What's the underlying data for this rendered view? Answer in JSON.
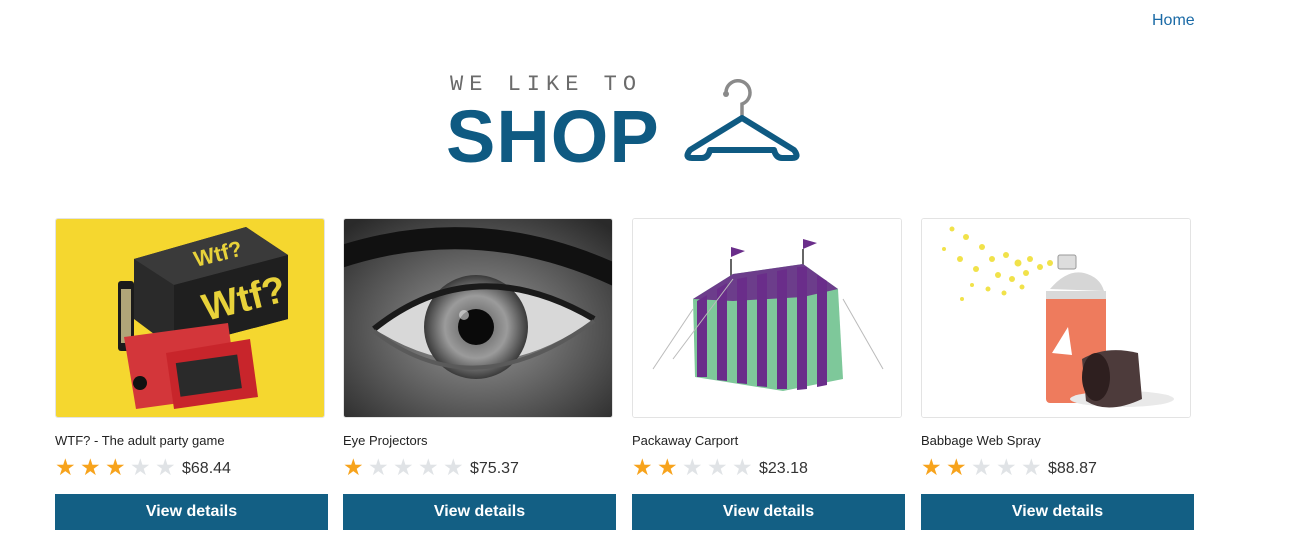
{
  "nav": {
    "home_label": "Home"
  },
  "logo": {
    "top_text": "WE LIKE TO",
    "main_text": "SHOP"
  },
  "products": [
    {
      "name": "WTF? - The adult party game",
      "rating": 3,
      "price": "$68.44",
      "button_label": "View details",
      "image": "party-game-box"
    },
    {
      "name": "Eye Projectors",
      "rating": 1,
      "price": "$75.37",
      "button_label": "View details",
      "image": "eye-closeup"
    },
    {
      "name": "Packaway Carport",
      "rating": 2,
      "price": "$23.18",
      "button_label": "View details",
      "image": "striped-tent"
    },
    {
      "name": "Babbage Web Spray",
      "rating": 2,
      "price": "$88.87",
      "button_label": "View details",
      "image": "spray-can"
    }
  ],
  "colors": {
    "accent": "#135f84",
    "star_on": "#f7a31c",
    "star_off": "#e0e3e6",
    "link": "#1a6aa6"
  }
}
